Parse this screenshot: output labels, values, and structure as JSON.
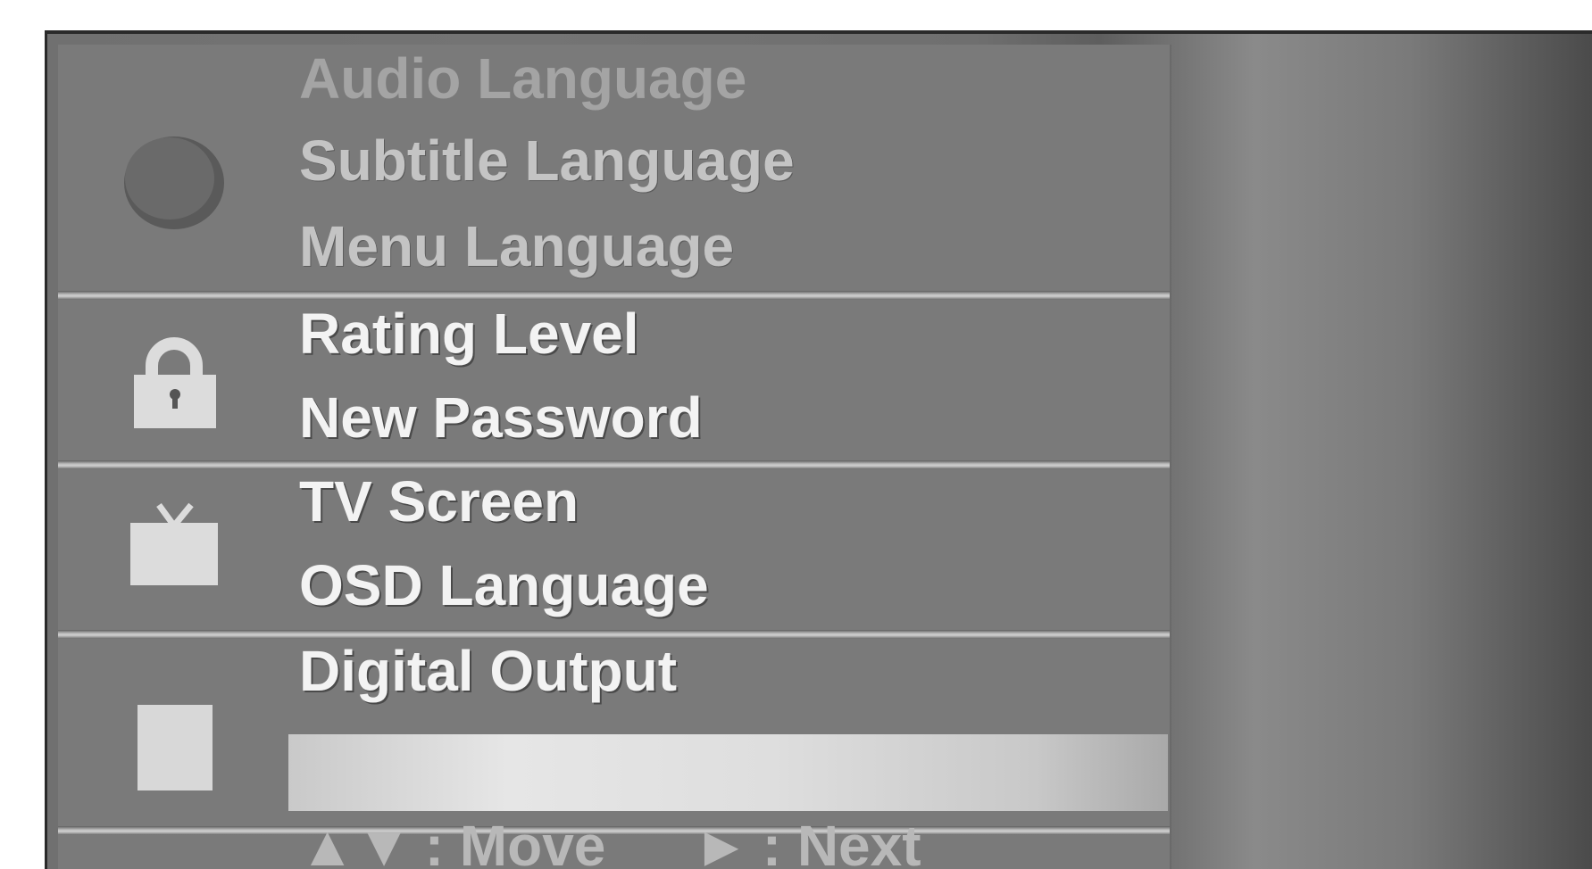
{
  "menu": {
    "sections": [
      {
        "icon": "disc-icon",
        "items": [
          "Audio Language",
          "Subtitle Language",
          "Menu Language"
        ]
      },
      {
        "icon": "lock-icon",
        "items": [
          "Rating Level",
          "New Password"
        ]
      },
      {
        "icon": "tv-icon",
        "items": [
          "TV Screen",
          "OSD Language"
        ]
      },
      {
        "icon": "audio-output-icon",
        "items": [
          "Digital Output",
          ""
        ]
      }
    ]
  },
  "footer": {
    "move_symbol": "▲▼",
    "move_label": ": Move",
    "next_symbol": "►",
    "next_label": ": Next"
  },
  "colors": {
    "panel": "#7a7a7a",
    "highlight": "#e6e6e6",
    "text": "#f3f3f3"
  }
}
